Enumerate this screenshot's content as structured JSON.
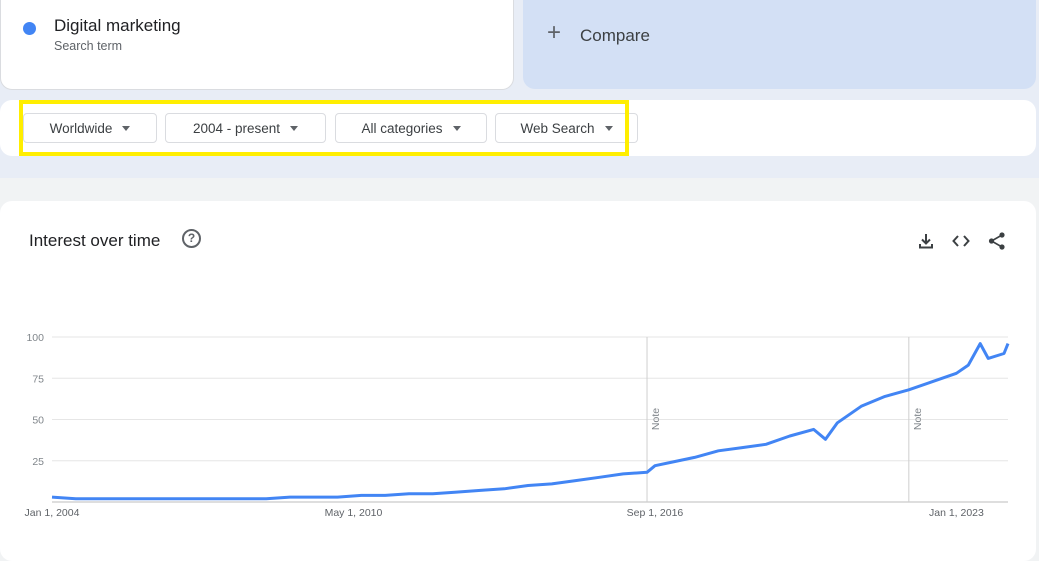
{
  "search_term": {
    "name": "Digital marketing",
    "subtitle": "Search term",
    "color": "#4285f4"
  },
  "compare": {
    "plus": "+",
    "label": "Compare"
  },
  "filters": {
    "region": "Worldwide",
    "time_range": "2004 - present",
    "category": "All categories",
    "search_type": "Web Search"
  },
  "highlight_color": "#ffee00",
  "chart_header": {
    "title": "Interest over time",
    "help_glyph": "?",
    "actions": [
      "download-icon",
      "embed-icon",
      "share-icon"
    ]
  },
  "chart_data": {
    "type": "line",
    "title": "Interest over time",
    "x_start": "2004-01",
    "x_end": "2024-02",
    "x_ticks": [
      "Jan 1, 2004",
      "May 1, 2010",
      "Sep 1, 2016",
      "Jan 1, 2023"
    ],
    "y_ticks": [
      "25",
      "50",
      "75",
      "100"
    ],
    "ylim": [
      0,
      100
    ],
    "grid": true,
    "annotations": [
      {
        "date": "2016-07",
        "text": "Note"
      },
      {
        "date": "2022-01",
        "text": "Note"
      }
    ],
    "series": [
      {
        "color": "#4285f4",
        "points": [
          [
            "2004-01",
            3
          ],
          [
            "2004-07",
            2
          ],
          [
            "2005-01",
            2
          ],
          [
            "2005-07",
            2
          ],
          [
            "2006-01",
            2
          ],
          [
            "2006-07",
            2
          ],
          [
            "2007-01",
            2
          ],
          [
            "2007-07",
            2
          ],
          [
            "2008-01",
            2
          ],
          [
            "2008-07",
            2
          ],
          [
            "2009-01",
            3
          ],
          [
            "2009-07",
            3
          ],
          [
            "2010-01",
            3
          ],
          [
            "2010-07",
            4
          ],
          [
            "2011-01",
            4
          ],
          [
            "2011-07",
            5
          ],
          [
            "2012-01",
            5
          ],
          [
            "2012-07",
            6
          ],
          [
            "2013-01",
            7
          ],
          [
            "2013-07",
            8
          ],
          [
            "2014-01",
            10
          ],
          [
            "2014-07",
            11
          ],
          [
            "2015-01",
            13
          ],
          [
            "2015-07",
            15
          ],
          [
            "2016-01",
            17
          ],
          [
            "2016-07",
            18
          ],
          [
            "2016-09",
            22
          ],
          [
            "2017-01",
            24
          ],
          [
            "2017-07",
            27
          ],
          [
            "2018-01",
            31
          ],
          [
            "2018-07",
            33
          ],
          [
            "2019-01",
            35
          ],
          [
            "2019-07",
            40
          ],
          [
            "2020-01",
            44
          ],
          [
            "2020-04",
            38
          ],
          [
            "2020-07",
            48
          ],
          [
            "2021-01",
            58
          ],
          [
            "2021-07",
            64
          ],
          [
            "2022-01",
            68
          ],
          [
            "2022-07",
            73
          ],
          [
            "2023-01",
            78
          ],
          [
            "2023-04",
            83
          ],
          [
            "2023-07",
            96
          ],
          [
            "2023-09",
            87
          ],
          [
            "2024-01",
            90
          ],
          [
            "2024-02",
            96
          ]
        ]
      }
    ]
  }
}
